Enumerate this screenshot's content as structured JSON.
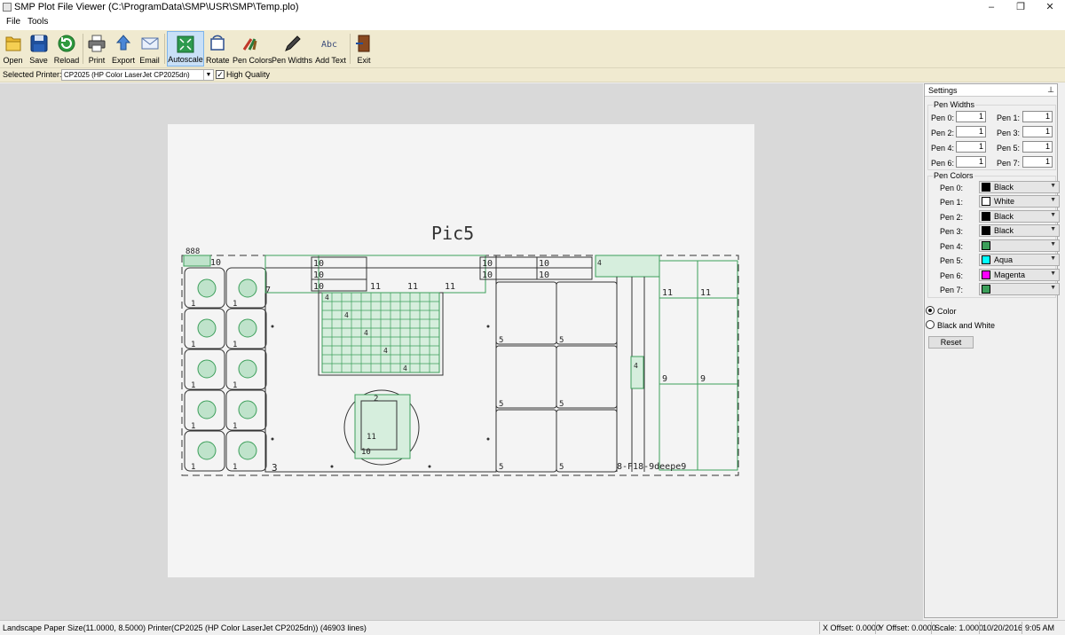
{
  "window": {
    "title": "SMP Plot File Viewer (C:\\ProgramData\\SMP\\USR\\SMP\\Temp.plo)",
    "controls": {
      "minimize": "–",
      "maximize": "❐",
      "close": "✕"
    }
  },
  "menu": {
    "file": "File",
    "tools": "Tools"
  },
  "toolbar": {
    "open": "Open",
    "save": "Save",
    "reload": "Reload",
    "print": "Print",
    "export": "Export",
    "email": "Email",
    "autoscale": "Autoscale",
    "rotate": "Rotate",
    "pen_colors": "Pen Colors",
    "pen_widths": "Pen Widths",
    "add_text": "Add Text",
    "exit": "Exit",
    "add_text_icon_text": "Abc"
  },
  "printer": {
    "label": "Selected Printer:",
    "value": "CP2025 (HP Color LaserJet CP2025dn)",
    "high_quality_label": "High Quality",
    "high_quality_checked": true
  },
  "plot": {
    "title": "Pic5",
    "labels": {
      "n10": "10",
      "n11": "11",
      "n7": "7",
      "n1": "1",
      "n3": "3",
      "n4": "4",
      "n5": "5",
      "n9": "9",
      "n2": "2",
      "n12": "12",
      "n88": "888",
      "bottom": "8-F18-9deepe9"
    }
  },
  "settings": {
    "header": "Settings",
    "pin_icon": "⊥",
    "pen_widths_title": "Pen Widths",
    "pen_widths": [
      {
        "label": "Pen 0:",
        "value": "1"
      },
      {
        "label": "Pen 1:",
        "value": "1"
      },
      {
        "label": "Pen 2:",
        "value": "1"
      },
      {
        "label": "Pen 3:",
        "value": "1"
      },
      {
        "label": "Pen 4:",
        "value": "1"
      },
      {
        "label": "Pen 5:",
        "value": "1"
      },
      {
        "label": "Pen 6:",
        "value": "1"
      },
      {
        "label": "Pen 7:",
        "value": "1"
      }
    ],
    "pen_colors_title": "Pen Colors",
    "pen_colors": [
      {
        "label": "Pen 0:",
        "name": "Black",
        "color": "#000000"
      },
      {
        "label": "Pen 1:",
        "name": "White",
        "color": "#ffffff"
      },
      {
        "label": "Pen 2:",
        "name": "Black",
        "color": "#000000"
      },
      {
        "label": "Pen 3:",
        "name": "Black",
        "color": "#000000"
      },
      {
        "label": "Pen 4:",
        "name": "",
        "color": "#3c9f5a"
      },
      {
        "label": "Pen 5:",
        "name": "Aqua",
        "color": "#00ffff"
      },
      {
        "label": "Pen 6:",
        "name": "Magenta",
        "color": "#ff00ff"
      },
      {
        "label": "Pen 7:",
        "name": "",
        "color": "#3c9f5a"
      }
    ],
    "mode_color": "Color",
    "mode_bw": "Black and White",
    "selected_mode": "Color",
    "reset": "Reset"
  },
  "status": {
    "left": "Landscape   Paper Size(11.0000, 8.5000)   Printer(CP2025 (HP Color LaserJet CP2025dn))   (46903 lines)",
    "x_offset": "X Offset: 0.0000",
    "y_offset": "Y Offset: 0.0000",
    "scale": "Scale: 1.0000",
    "date": "10/20/2016",
    "time": "9:05 AM"
  },
  "colors": {
    "plot_green": "#3c9f5a",
    "toolbar_bg": "#f0ead0",
    "canvas_bg": "#d9d9d9"
  }
}
